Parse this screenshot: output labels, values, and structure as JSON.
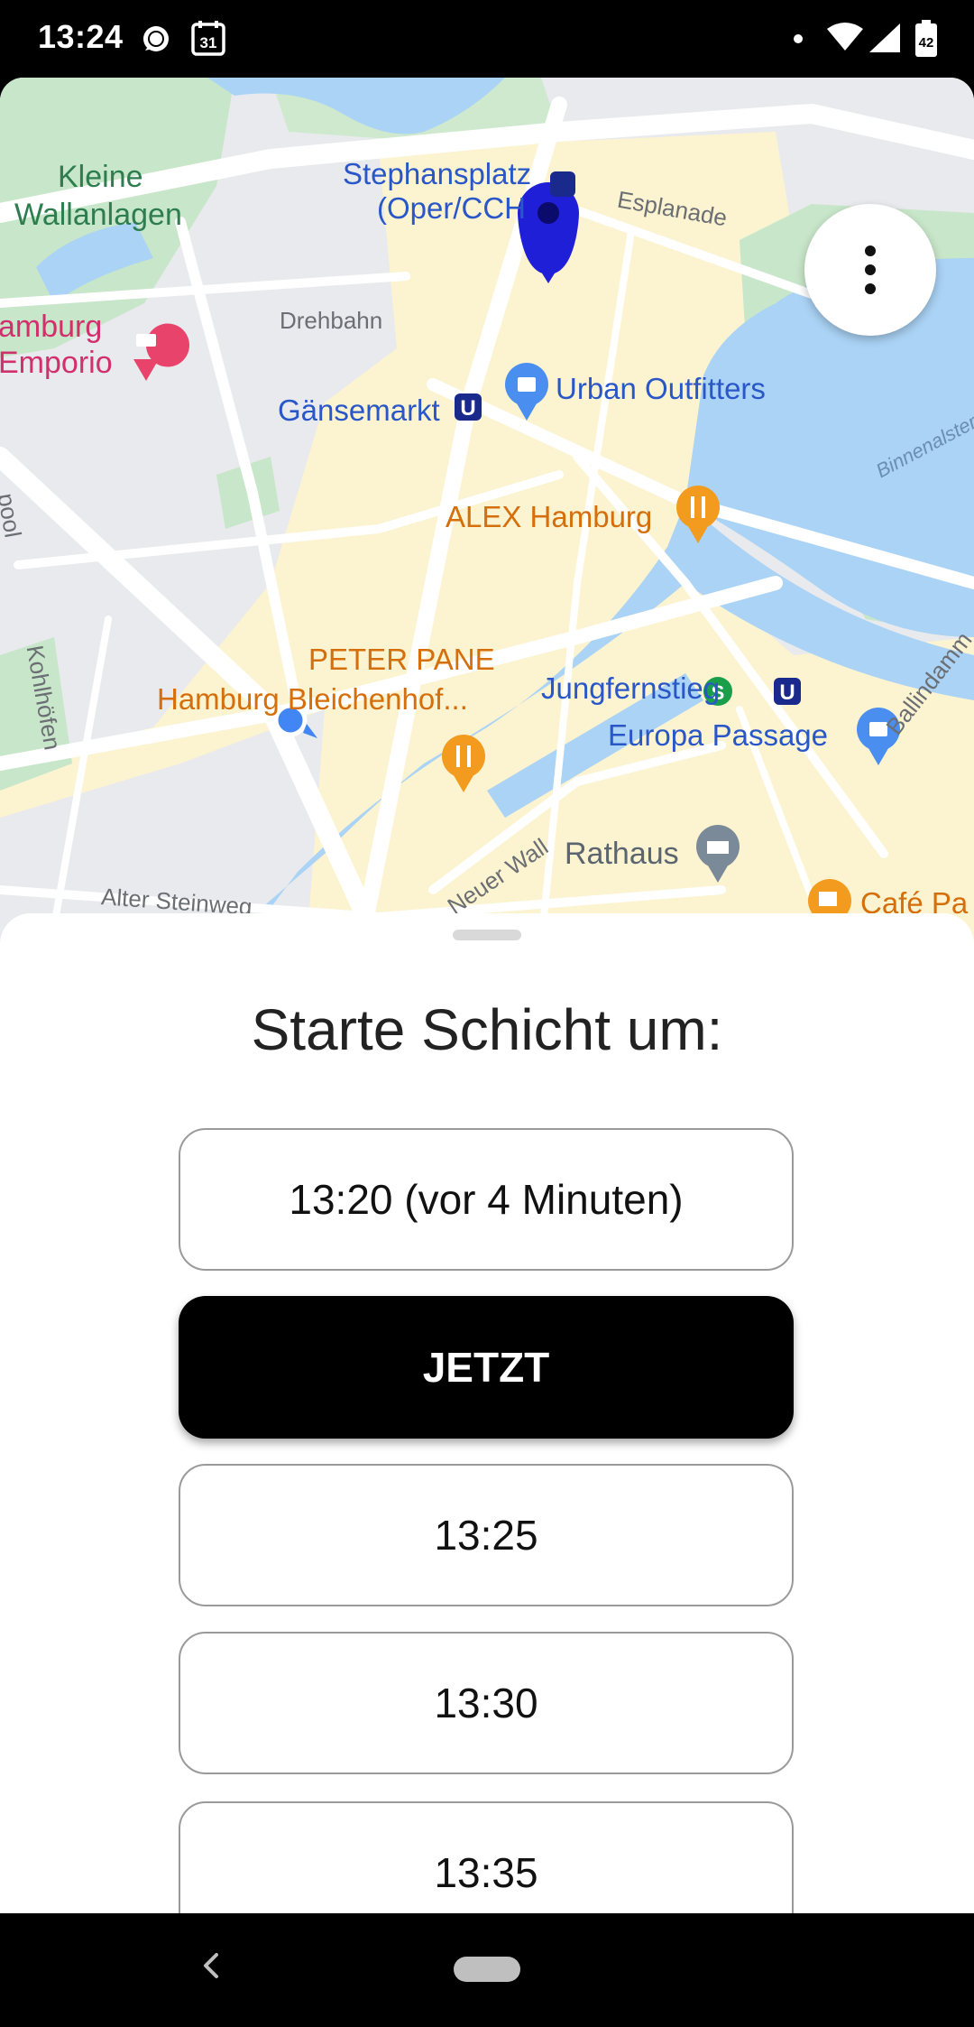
{
  "status_bar": {
    "time": "13:24",
    "calendar_day": "31",
    "battery_level": "42",
    "icons": [
      "chat-bubble-icon",
      "calendar-icon",
      "notification-dot-icon",
      "wifi-icon",
      "cell-signal-icon",
      "battery-icon"
    ]
  },
  "map": {
    "labels": {
      "kleine_1": "Kleine",
      "kleine_2": "Wallanlagen",
      "stephansplatz_1": "Stephansplatz",
      "stephansplatz_2": "(Oper/CCH",
      "esplanade": "Esplanade",
      "hamburg_emporio_1": "amburg",
      "hamburg_emporio_2": "Emporio",
      "drehbahn": "Drehbahn",
      "gaensemarkt": "Gänsemarkt",
      "urban_outfitters": "Urban Outfitters",
      "binnenalster": "Binnenalster",
      "alex_hamburg": "ALEX Hamburg",
      "pool": "pool",
      "kohlhoefen": "Kohlhöfen",
      "peter_pane_1": "PETER PANE",
      "peter_pane_2": "Hamburg Bleichenhof...",
      "jungfernstieg": "Jungfernstieg",
      "ballindamm": "Ballindamm",
      "europa_passage": "Europa Passage",
      "neuer_wall": "Neuer Wall",
      "rathaus": "Rathaus",
      "alter_steinweg": "Alter Steinweg",
      "cafe": "Café Pa"
    },
    "colors": {
      "land": "#e8eaed",
      "commercial": "#fcf3d0",
      "park": "#c8e6c9",
      "water": "#aad3f5",
      "road": "#ffffff",
      "pin": "#1f1fd8",
      "my_location": "#4285f4"
    }
  },
  "sheet": {
    "title": "Starte Schicht um:",
    "options": [
      {
        "label": "13:20 (vor 4 Minuten)",
        "selected": false
      },
      {
        "label": "JETZT",
        "selected": true
      },
      {
        "label": "13:25",
        "selected": false
      },
      {
        "label": "13:30",
        "selected": false
      },
      {
        "label": "13:35",
        "selected": false
      }
    ]
  },
  "nav_bar": {
    "icons": [
      "back-icon",
      "home-pill-icon"
    ]
  }
}
